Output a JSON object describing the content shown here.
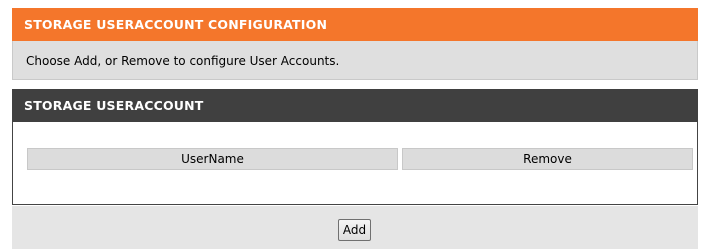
{
  "config_section": {
    "title": "STORAGE USERACCOUNT CONFIGURATION",
    "description": "Choose Add, or Remove to configure User Accounts.",
    "header_color": "#f4762b"
  },
  "account_section": {
    "title": "STORAGE USERACCOUNT",
    "header_color": "#404040",
    "table": {
      "columns": [
        "UserName",
        "Remove"
      ],
      "rows": []
    }
  },
  "actions": {
    "add_label": "Add"
  }
}
